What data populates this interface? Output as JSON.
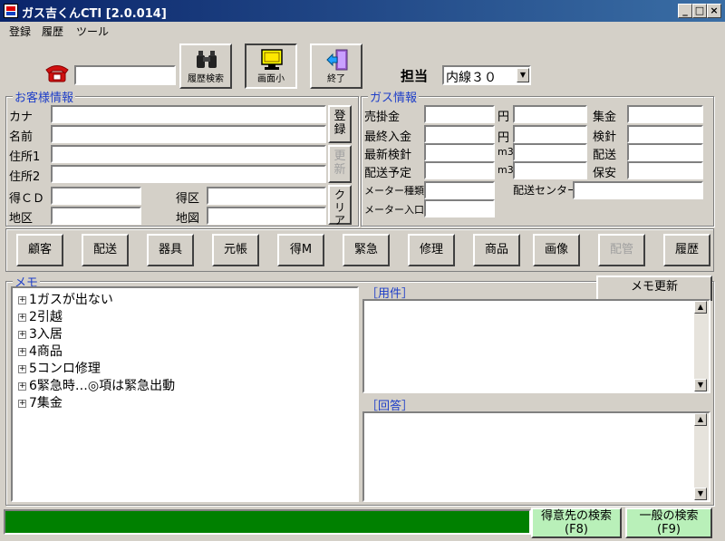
{
  "window": {
    "title": "ガス吉くんCTI [2.0.014]",
    "min": "_",
    "max": "□",
    "close": "×"
  },
  "menu": [
    "登録",
    "履歴",
    "ツール"
  ],
  "toolbar": {
    "history_search": "履歴検索",
    "screen_small": "画面小",
    "exit": "終了",
    "staff_label": "担当",
    "staff_value": "内線３０",
    "phone_value": ""
  },
  "customer": {
    "group_label": "お客様情報",
    "kana": "カナ",
    "name": "名前",
    "address1": "住所1",
    "address2": "住所2",
    "tokucd": "得ＣＤ",
    "tokuku": "得区",
    "chiku": "地区",
    "chizu": "地図",
    "register_btn": "登録",
    "update_btn": "更新",
    "clear_btn": "クリア"
  },
  "gas": {
    "group_label": "ガス情報",
    "urikake": "売掛金",
    "last_payment": "最終入金",
    "latest_meter": "最新検針",
    "delivery_plan": "配送予定",
    "meter_type": "メーター種類",
    "meter_inlet": "メーター入口",
    "unit_yen1": "円",
    "unit_yen2": "円",
    "unit_m3a": "m3",
    "unit_m3b": "m3",
    "shukin": "集金",
    "kenshin": "検針",
    "haiso": "配送",
    "hoan": "保安",
    "haiso_center": "配送センター"
  },
  "nav": [
    "顧客",
    "配送",
    "器具",
    "元帳",
    "得M",
    "緊急",
    "修理",
    "商品",
    "画像",
    "配管",
    "履歴"
  ],
  "memo": {
    "label": "メモ",
    "update_btn": "メモ更新",
    "items": [
      "1ガスが出ない",
      "2引越",
      "3入居",
      "4商品",
      "5コンロ修理",
      "6緊急時…◎項は緊急出動",
      "7集金"
    ],
    "youken_label": "［用件］",
    "kaitou_label": "［回答］"
  },
  "status": {
    "customer_search": "得意先の検索",
    "customer_search_key": "(F8)",
    "general_search": "一般の検索",
    "general_search_key": "(F9)"
  },
  "colors": {
    "accent": "#1f3fc8",
    "status_bar": "#008000",
    "status_btn": "#b9f0b9"
  }
}
